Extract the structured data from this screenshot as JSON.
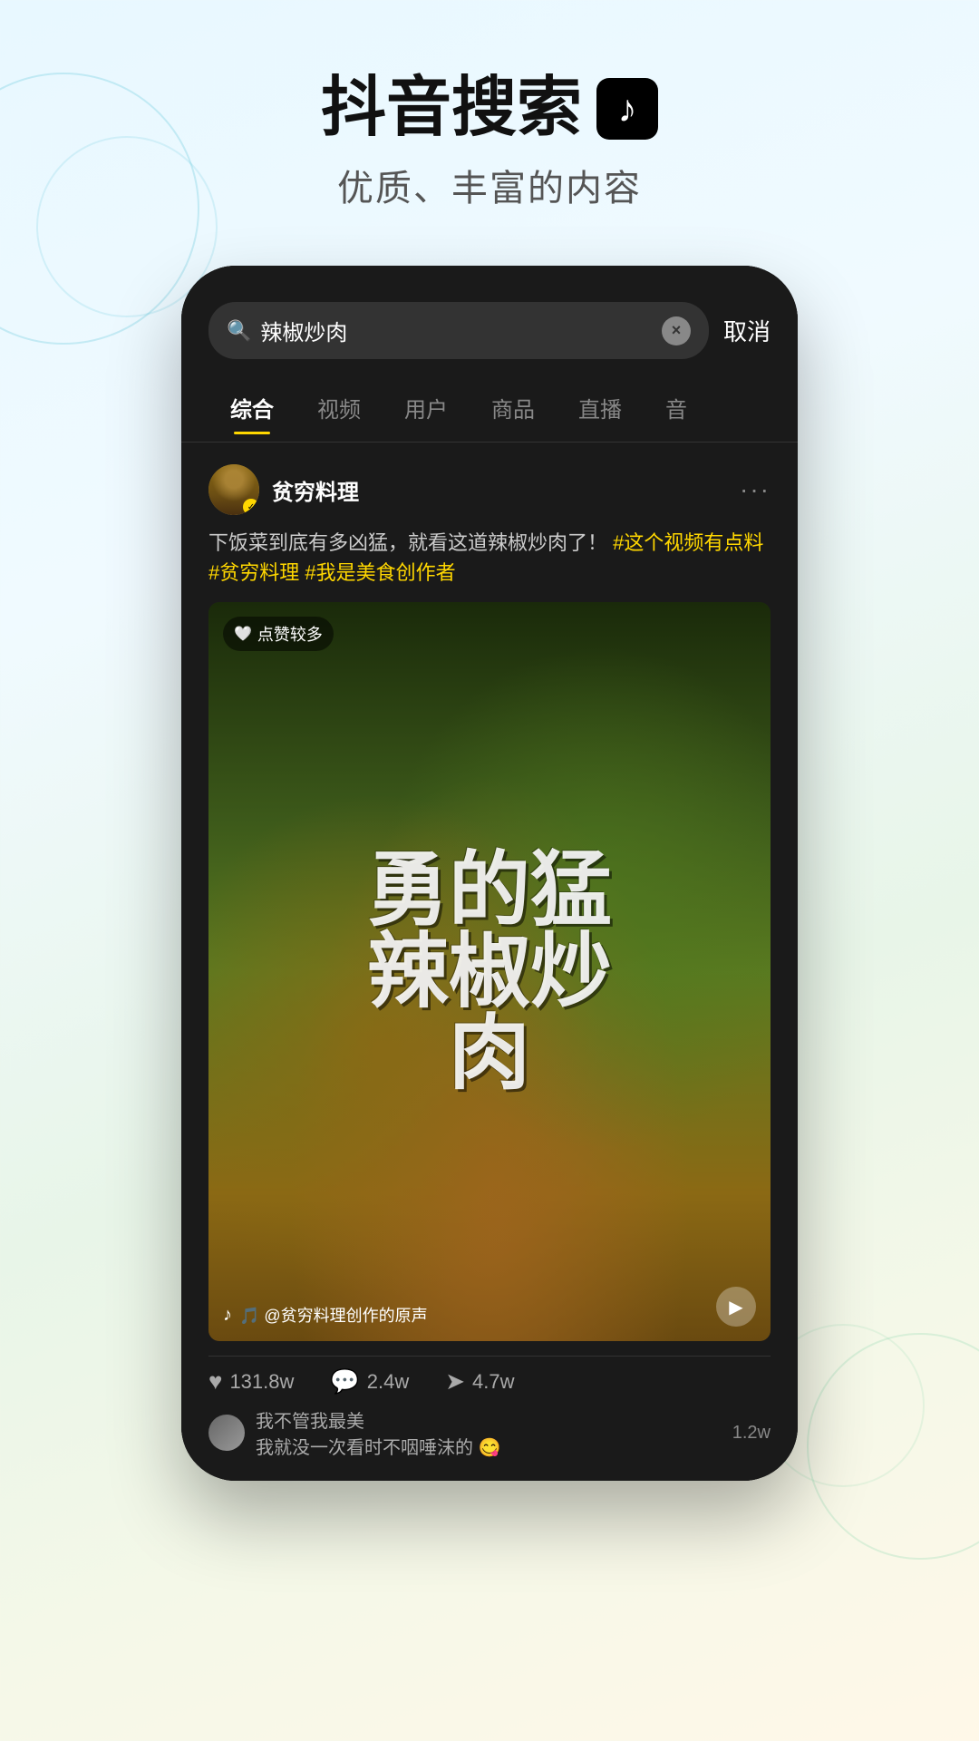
{
  "header": {
    "main_title": "抖音搜索",
    "subtitle": "优质、丰富的内容"
  },
  "phone": {
    "search": {
      "query": "辣椒炒肉",
      "cancel_label": "取消",
      "clear_icon": "×"
    },
    "tabs": [
      {
        "label": "综合",
        "active": true
      },
      {
        "label": "视频",
        "active": false
      },
      {
        "label": "用户",
        "active": false
      },
      {
        "label": "商品",
        "active": false
      },
      {
        "label": "直播",
        "active": false
      },
      {
        "label": "音",
        "active": false
      }
    ],
    "card": {
      "username": "贫穷料理",
      "description": "下饭菜到底有多凶猛，就看这道辣椒炒肉了！",
      "hashtags": [
        "#这个视频有点料",
        "#贫穷料理",
        "#我是美食创作者"
      ],
      "likes_badge": "点赞较多",
      "video_text": "勇的猛辣椒炒肉",
      "sound_info": "🎵 @贫穷料理创作的原声",
      "stats": [
        {
          "icon": "♥",
          "value": "131.8w"
        },
        {
          "icon": "💬",
          "value": "2.4w"
        },
        {
          "icon": "➤",
          "value": "4.7w"
        }
      ],
      "comment_text": "我不管我最美",
      "comment_sub": "我就没一次看时不咽唾沫的 😋",
      "comment_count": "1.2w"
    }
  }
}
